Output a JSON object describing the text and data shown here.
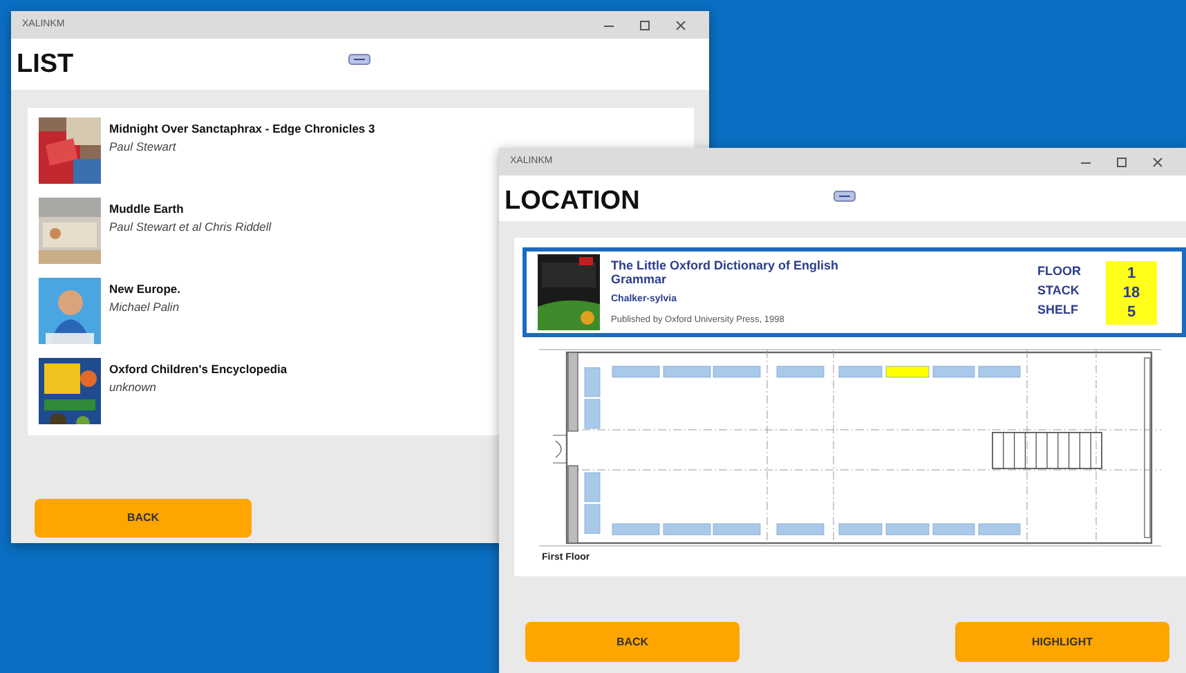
{
  "list_window": {
    "title": "XALINKM",
    "heading": "LIST",
    "books": [
      {
        "title": "Midnight Over Sanctaphrax - Edge Chronicles 3",
        "author": "Paul Stewart"
      },
      {
        "title": "Muddle Earth",
        "author": "Paul Stewart et al Chris Riddell"
      },
      {
        "title": "New Europe.",
        "author": "Michael Palin"
      },
      {
        "title": "Oxford Children's Encyclopedia",
        "author": "unknown"
      }
    ],
    "back_button": "BACK"
  },
  "location_window": {
    "title": "XALINKM",
    "heading": "LOCATION",
    "book": {
      "title": "The Little Oxford Dictionary of English Grammar",
      "author": "Chalker-sylvia",
      "publisher": "Published by Oxford University Press, 1998"
    },
    "location": [
      {
        "label": "FLOOR",
        "value": "1"
      },
      {
        "label": "STACK",
        "value": "18"
      },
      {
        "label": "SHELF",
        "value": "5"
      }
    ],
    "floor_plan": {
      "caption": "First Floor",
      "top_row": [
        {
          "highlighted": false
        },
        {
          "highlighted": false
        },
        {
          "highlighted": false
        },
        {
          "highlighted": false
        },
        {
          "highlighted": false
        },
        {
          "highlighted": true
        },
        {
          "highlighted": false
        },
        {
          "highlighted": false
        }
      ],
      "bottom_row": [
        {
          "highlighted": false
        },
        {
          "highlighted": false
        },
        {
          "highlighted": false
        },
        {
          "highlighted": false
        },
        {
          "highlighted": false
        },
        {
          "highlighted": false
        },
        {
          "highlighted": false
        },
        {
          "highlighted": false
        }
      ]
    },
    "buttons": [
      "BACK",
      "HIGHLIGHT"
    ]
  }
}
